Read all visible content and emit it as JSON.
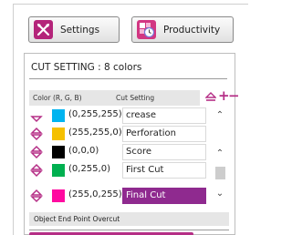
{
  "toolbar": {
    "settings_label": "Settings",
    "productivity_label": "Productivity"
  },
  "panel": {
    "title": "CUT SETTING : 8 colors",
    "header": {
      "color_col": "Color (R, G, B)",
      "cut_col": "Cut Setting"
    },
    "rows": [
      {
        "color": "#00b4f0",
        "rgb": "(0,255,255)",
        "cut": "crease",
        "selected": false
      },
      {
        "color": "#f5c000",
        "rgb": "(255,255,0)",
        "cut": "Perforation",
        "selected": false
      },
      {
        "color": "#000000",
        "rgb": "(0,0,0)",
        "cut": "Score",
        "selected": false
      },
      {
        "color": "#00b050",
        "rgb": "(0,255,0)",
        "cut": "First Cut",
        "selected": false
      },
      {
        "color": "#ff0aa0",
        "rgb": "(255,0,255)",
        "cut": "Final Cut",
        "selected": true
      }
    ],
    "overcut_label": "Object End Point Overcut"
  },
  "colors": {
    "accent": "#b52e86",
    "selected_bg": "#8f2a8f",
    "header_bg": "#e6e6e6"
  }
}
